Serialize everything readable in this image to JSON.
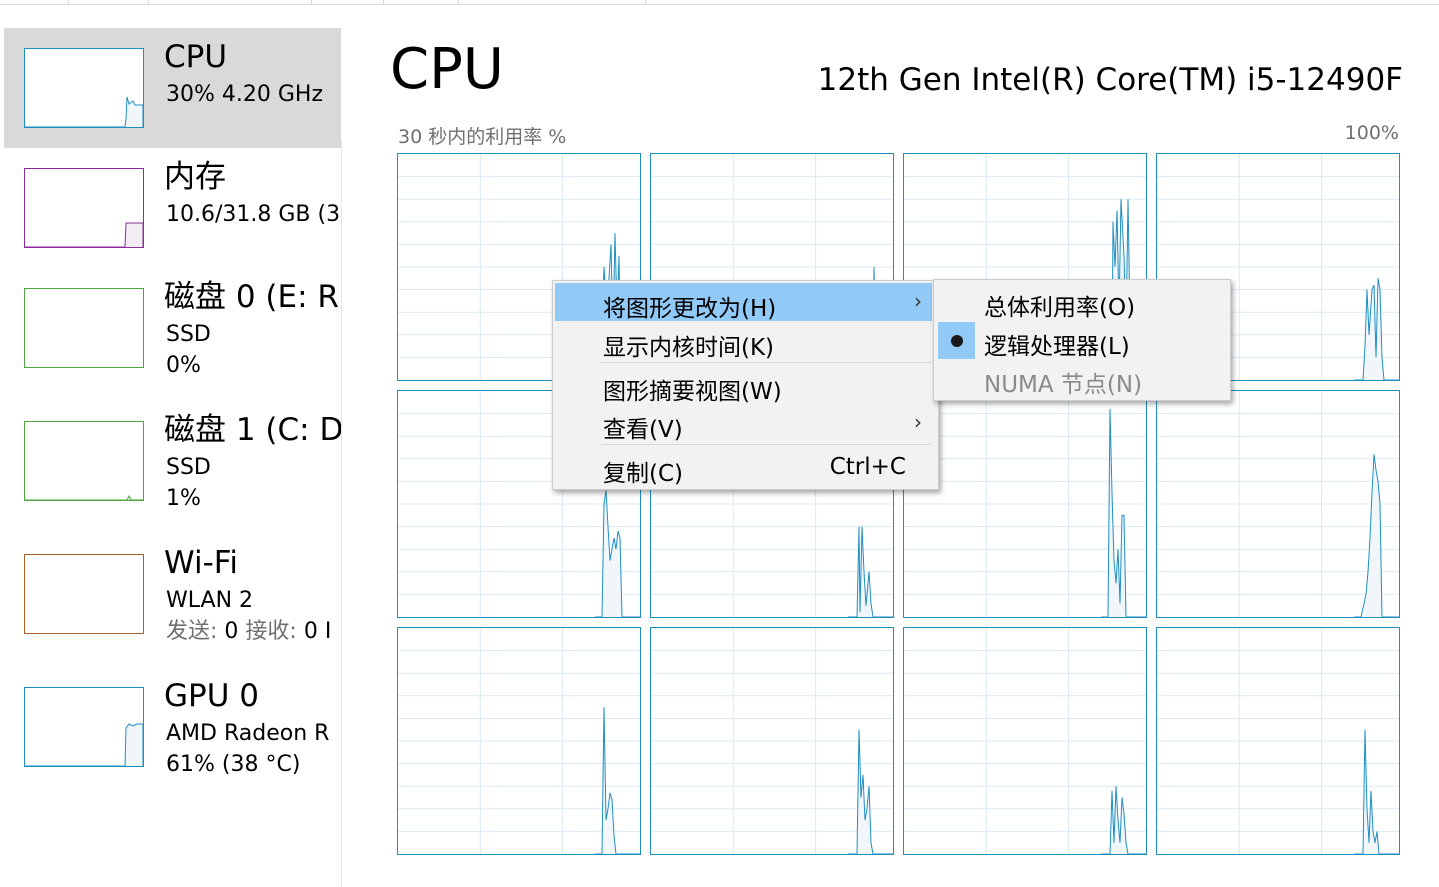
{
  "sidebar": {
    "items": [
      {
        "name": "CPU",
        "line1": "30%  4.20 GHz",
        "line2": "",
        "line2_values": "",
        "color": "#1f8fc1",
        "selected": true
      },
      {
        "name": "内存",
        "line1": "10.6/31.8 GB (3",
        "line2": "",
        "color": "#8b2c9b",
        "selected": false
      },
      {
        "name": "磁盘 0 (E: R:",
        "line1": "SSD",
        "line2": "0%",
        "color": "#4da63e",
        "selected": false
      },
      {
        "name": "磁盘 1 (C: D",
        "line1": "SSD",
        "line2": "1%",
        "color": "#4da63e",
        "selected": false
      },
      {
        "name": "Wi-Fi",
        "line1": "WLAN 2",
        "line2_send_label": "发送:",
        "line2_send_value": "0",
        "line2_recv_label": "接收:",
        "line2_recv_value": "0 I",
        "color": "#a75f23",
        "selected": false
      },
      {
        "name": "GPU 0",
        "line1": "AMD Radeon R",
        "line2": "61%  (38 °C)",
        "color": "#1f8fc1",
        "selected": false
      }
    ]
  },
  "main": {
    "title": "CPU",
    "model": "12th Gen Intel(R) Core(TM) i5-12490F",
    "util_label": "30 秒内的利用率 %",
    "util_max": "100%",
    "graph_color": "#1f8fc1",
    "graph_fill": "#f1f6fb",
    "grid_color": "#d9eaf4",
    "processor_count": 12
  },
  "context_menu": {
    "items": [
      {
        "label": "将图形更改为(H)",
        "has_submenu": true,
        "highlighted": true
      },
      {
        "label": "显示内核时间(K)",
        "has_submenu": false
      },
      {
        "label": "图形摘要视图(W)",
        "has_submenu": false
      },
      {
        "label": "查看(V)",
        "has_submenu": true
      },
      {
        "label": "复制(C)",
        "shortcut": "Ctrl+C"
      }
    ],
    "submenu_arrow": "›"
  },
  "submenu": {
    "items": [
      {
        "label": "总体利用率(O)",
        "selected": false,
        "disabled": false
      },
      {
        "label": "逻辑处理器(L)",
        "selected": true,
        "disabled": false
      },
      {
        "label": "NUMA 节点(N)",
        "selected": false,
        "disabled": true
      }
    ]
  }
}
